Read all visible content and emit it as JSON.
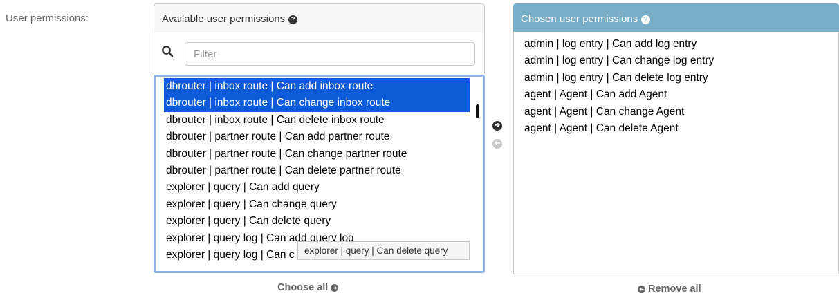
{
  "field_label": "User permissions:",
  "available": {
    "title": "Available user permissions",
    "filter_placeholder": "Filter",
    "options": [
      {
        "label": "dbrouter | inbox route | Can add inbox route",
        "selected": true
      },
      {
        "label": "dbrouter | inbox route | Can change inbox route",
        "selected": true
      },
      {
        "label": "dbrouter | inbox route | Can delete inbox route",
        "selected": false
      },
      {
        "label": "dbrouter | partner route | Can add partner route",
        "selected": false
      },
      {
        "label": "dbrouter | partner route | Can change partner route",
        "selected": false
      },
      {
        "label": "dbrouter | partner route | Can delete partner route",
        "selected": false
      },
      {
        "label": "explorer | query | Can add query",
        "selected": false
      },
      {
        "label": "explorer | query | Can change query",
        "selected": false
      },
      {
        "label": "explorer | query | Can delete query",
        "selected": false
      },
      {
        "label": "explorer | query log | Can add query log",
        "selected": false
      },
      {
        "label": "explorer | query log | Can c",
        "selected": false
      }
    ],
    "tooltip": "explorer | query | Can delete query",
    "choose_all": "Choose all"
  },
  "chosen": {
    "title": "Chosen user permissions",
    "options": [
      "admin | log entry | Can add log entry",
      "admin | log entry | Can change log entry",
      "admin | log entry | Can delete log entry",
      "agent | Agent | Can add Agent",
      "agent | Agent | Can change Agent",
      "agent | Agent | Can delete Agent"
    ],
    "remove_all": "Remove all"
  },
  "icons": {
    "help": "question-circle-icon",
    "search": "search-icon",
    "add": "arrow-right-circle-icon",
    "remove": "arrow-left-circle-icon"
  },
  "colors": {
    "chosen_header": "#79aec8",
    "selected_option": "#0d5bd8",
    "focus_border": "#8fb3e9"
  }
}
